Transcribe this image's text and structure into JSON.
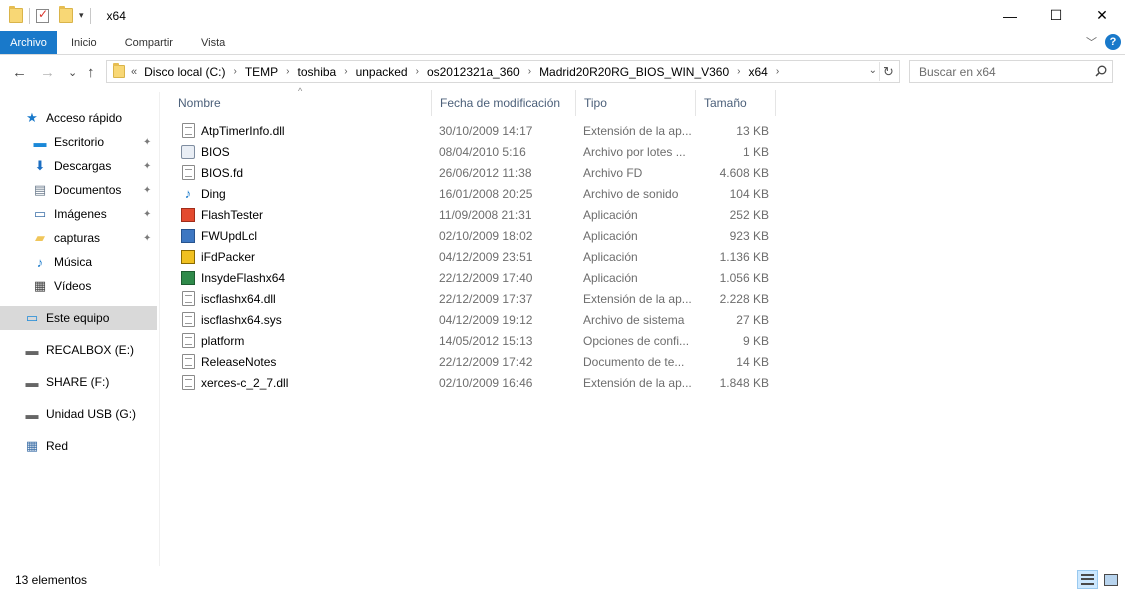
{
  "window": {
    "title": "x64",
    "minimize_icon": "—",
    "maximize_icon": "☐",
    "close_icon": "✕"
  },
  "ribbon": {
    "tabs": [
      "Archivo",
      "Inicio",
      "Compartir",
      "Vista"
    ],
    "expand_icon": "﹀",
    "help_icon": "?"
  },
  "nav": {
    "back": "←",
    "forward": "→",
    "recent": "⌄",
    "up": "↑"
  },
  "address": {
    "overflow": "«",
    "crumbs": [
      "Disco local (C:)",
      "TEMP",
      "toshiba",
      "unpacked",
      "os2012321a_360",
      "Madrid20R20RG_BIOS_WIN_V360",
      "x64"
    ],
    "separator": "›",
    "dropdown_icon": "⌄",
    "refresh_icon": "↻"
  },
  "search": {
    "placeholder": "Buscar en x64"
  },
  "sidebar": {
    "pin_icon": "📌",
    "items": [
      {
        "label": "Acceso rápido",
        "icon": "★",
        "icon_color": "#1979ca",
        "pinned": false
      },
      {
        "label": "Escritorio",
        "icon": "▬",
        "icon_color": "#1b88d8",
        "pinned": true
      },
      {
        "label": "Descargas",
        "icon": "⬇",
        "icon_color": "#1b6ec2",
        "pinned": true
      },
      {
        "label": "Documentos",
        "icon": "▤",
        "icon_color": "#6b7b8c",
        "pinned": true
      },
      {
        "label": "Imágenes",
        "icon": "▭",
        "icon_color": "#3c6fa7",
        "pinned": true
      },
      {
        "label": "capturas",
        "icon": "▰",
        "icon_color": "#f0c65a",
        "pinned": true
      },
      {
        "label": "Música",
        "icon": "♪",
        "icon_color": "#1979ca",
        "pinned": false
      },
      {
        "label": "Vídeos",
        "icon": "▦",
        "icon_color": "#444444",
        "pinned": false
      },
      {
        "label": "Este equipo",
        "icon": "▭",
        "icon_color": "#1b88d8",
        "pinned": false
      },
      {
        "label": "RECALBOX (E:)",
        "icon": "▬",
        "icon_color": "#666666",
        "pinned": false
      },
      {
        "label": "SHARE (F:)",
        "icon": "▬",
        "icon_color": "#666666",
        "pinned": false
      },
      {
        "label": "Unidad USB (G:)",
        "icon": "▬",
        "icon_color": "#666666",
        "pinned": false
      },
      {
        "label": "Red",
        "icon": "▦",
        "icon_color": "#3c6fa7",
        "pinned": false
      }
    ]
  },
  "columns": {
    "name": "Nombre",
    "date": "Fecha de modificación",
    "type": "Tipo",
    "size": "Tamaño",
    "sort_indicator": "^"
  },
  "files": [
    {
      "name": "AtpTimerInfo.dll",
      "date": "30/10/2009 14:17",
      "type": "Extensión de la ap...",
      "size": "13 KB",
      "icon": "gear-doc"
    },
    {
      "name": "BIOS",
      "date": "08/04/2010 5:16",
      "type": "Archivo por lotes ...",
      "size": "1 KB",
      "icon": "gear"
    },
    {
      "name": "BIOS.fd",
      "date": "26/06/2012 11:38",
      "type": "Archivo FD",
      "size": "4.608 KB",
      "icon": "doc"
    },
    {
      "name": "Ding",
      "date": "16/01/2008 20:25",
      "type": "Archivo de sonido",
      "size": "104 KB",
      "icon": "music"
    },
    {
      "name": "FlashTester",
      "date": "11/09/2008 21:31",
      "type": "Aplicación",
      "size": "252 KB",
      "icon": "flash"
    },
    {
      "name": "FWUpdLcl",
      "date": "02/10/2009 18:02",
      "type": "Aplicación",
      "size": "923 KB",
      "icon": "app"
    },
    {
      "name": "iFdPacker",
      "date": "04/12/2009 23:51",
      "type": "Aplicación",
      "size": "1.136 KB",
      "icon": "yellow"
    },
    {
      "name": "InsydeFlashx64",
      "date": "22/12/2009 17:40",
      "type": "Aplicación",
      "size": "1.056 KB",
      "icon": "green"
    },
    {
      "name": "iscflashx64.dll",
      "date": "22/12/2009 17:37",
      "type": "Extensión de la ap...",
      "size": "2.228 KB",
      "icon": "gear-doc"
    },
    {
      "name": "iscflashx64.sys",
      "date": "04/12/2009 19:12",
      "type": "Archivo de sistema",
      "size": "27 KB",
      "icon": "gear-doc"
    },
    {
      "name": "platform",
      "date": "14/05/2012 15:13",
      "type": "Opciones de confi...",
      "size": "9 KB",
      "icon": "gear-doc"
    },
    {
      "name": "ReleaseNotes",
      "date": "22/12/2009 17:42",
      "type": "Documento de te...",
      "size": "14 KB",
      "icon": "doc"
    },
    {
      "name": "xerces-c_2_7.dll",
      "date": "02/10/2009 16:46",
      "type": "Extensión de la ap...",
      "size": "1.848 KB",
      "icon": "gear-doc"
    }
  ],
  "status": {
    "count": "13 elementos"
  }
}
